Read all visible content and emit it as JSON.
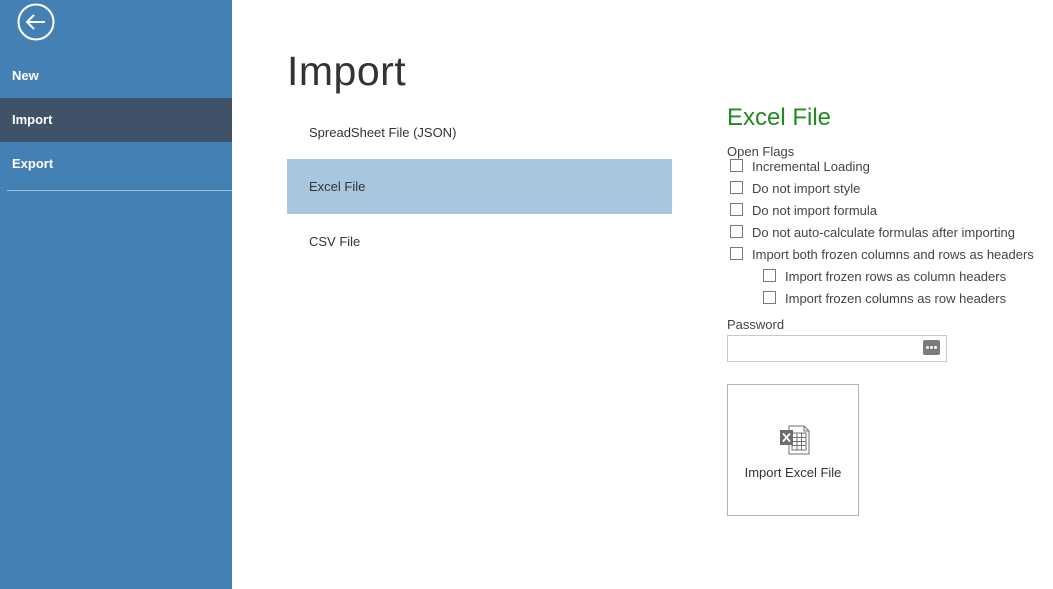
{
  "sidebar": {
    "back_icon": "back-arrow-icon",
    "items": [
      {
        "label": "New",
        "active": false
      },
      {
        "label": "Import",
        "active": true
      },
      {
        "label": "Export",
        "active": false
      }
    ],
    "background": "#4580b5",
    "active_background": "#3f5268"
  },
  "main": {
    "title": "Import",
    "file_types": [
      {
        "label": "SpreadSheet File (JSON)",
        "selected": false
      },
      {
        "label": "Excel File",
        "selected": true
      },
      {
        "label": "CSV File",
        "selected": false
      }
    ],
    "selected_background": "#a9c6df"
  },
  "panel": {
    "title": "Excel File",
    "title_color": "#218b22",
    "open_flags_label": "Open Flags",
    "flags": [
      {
        "label": "Incremental Loading",
        "checked": false
      },
      {
        "label": "Do not import style",
        "checked": false
      },
      {
        "label": "Do not import formula",
        "checked": false
      },
      {
        "label": "Do not auto-calculate formulas after importing",
        "checked": false
      },
      {
        "label": "Import both frozen columns and rows as headers",
        "checked": false
      },
      {
        "label": "Import frozen rows as column headers",
        "checked": false
      },
      {
        "label": "Import frozen columns as row headers",
        "checked": false
      }
    ],
    "password_label": "Password",
    "password_value": "",
    "password_reveal_icon": "password-reveal-icon",
    "import_button_label": "Import Excel File",
    "import_button_icon": "excel-file-icon"
  }
}
